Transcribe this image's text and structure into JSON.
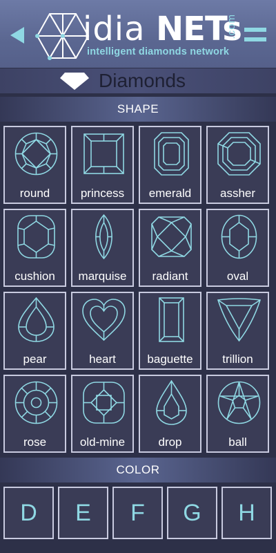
{
  "header": {
    "logo_text_1": "idia",
    "logo_text_2": "NETs",
    "logo_domain": ".com",
    "tagline": "intelligent diamonds network",
    "back_icon": "back-arrow-icon",
    "menu_icon": "hamburger-menu-icon"
  },
  "section": {
    "title": "Diamonds",
    "icon": "diamond-icon"
  },
  "shape": {
    "heading": "SHAPE",
    "items": [
      {
        "label": "round"
      },
      {
        "label": "princess"
      },
      {
        "label": "emerald"
      },
      {
        "label": "assher"
      },
      {
        "label": "cushion"
      },
      {
        "label": "marquise"
      },
      {
        "label": "radiant"
      },
      {
        "label": "oval"
      },
      {
        "label": "pear"
      },
      {
        "label": "heart"
      },
      {
        "label": "baguette"
      },
      {
        "label": "trillion"
      },
      {
        "label": "rose"
      },
      {
        "label": "old-mine"
      },
      {
        "label": "drop"
      },
      {
        "label": "ball"
      }
    ]
  },
  "color": {
    "heading": "COLOR",
    "items": [
      {
        "label": "D"
      },
      {
        "label": "E"
      },
      {
        "label": "F"
      },
      {
        "label": "G"
      },
      {
        "label": "H"
      }
    ]
  },
  "colors": {
    "accent": "#8fd8e3",
    "header_bg": "#5b6791",
    "body_bg": "#2d3048",
    "cell_border": "#c9cbe0"
  }
}
